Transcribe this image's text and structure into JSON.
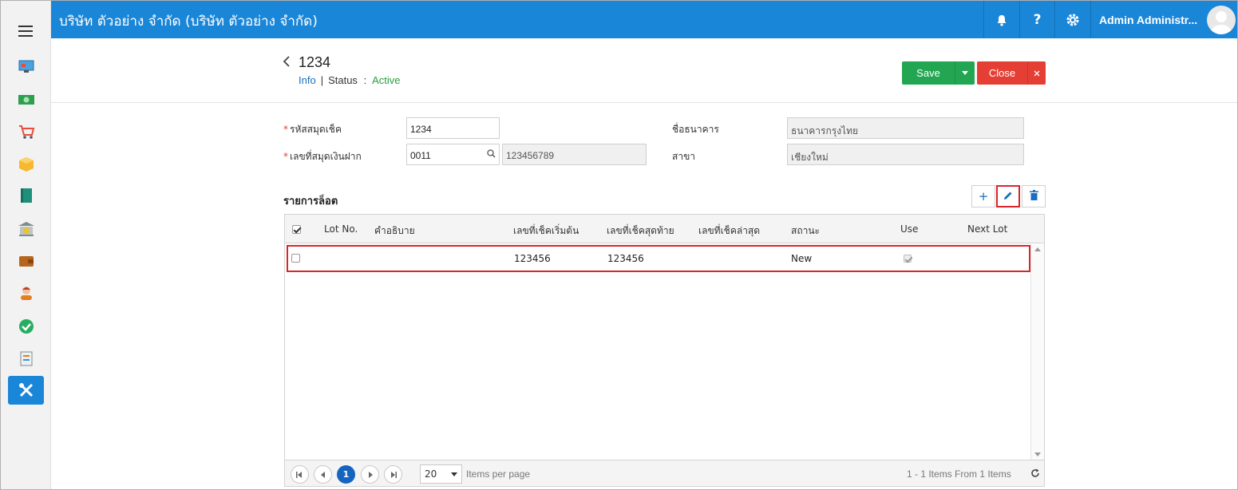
{
  "topbar": {
    "company": "บริษัท ตัวอย่าง จำกัด (บริษัท ตัวอย่าง จำกัด)",
    "help_label": "?",
    "user_name": "Admin Administr..."
  },
  "sidebar": {
    "items": [
      {
        "icon": "dashboard-icon"
      },
      {
        "icon": "money-icon"
      },
      {
        "icon": "cart-icon"
      },
      {
        "icon": "box-icon"
      },
      {
        "icon": "book-icon"
      },
      {
        "icon": "bank-icon"
      },
      {
        "icon": "wallet-icon"
      },
      {
        "icon": "person-icon"
      },
      {
        "icon": "check-circle-icon"
      },
      {
        "icon": "report-icon"
      },
      {
        "icon": "tools-icon",
        "active": true
      }
    ]
  },
  "header": {
    "title": "1234",
    "info_link": "Info",
    "separator": "|",
    "status_label": "Status",
    "status_colon": ":",
    "status_value": "Active",
    "save_label": "Save",
    "close_label": "Close"
  },
  "form": {
    "checkbook_code_label": "รหัสสมุดเช็ค",
    "checkbook_code_value": "1234",
    "account_no_label": "เลขที่สมุดเงินฝาก",
    "account_no_value": "0011",
    "account_name_value": "123456789",
    "bank_label": "ชื่อธนาคาร",
    "bank_value": "ธนาคารกรุงไทย",
    "branch_label": "สาขา",
    "branch_value": "เชียงใหม่"
  },
  "lot_section": {
    "title": "รายการล็อต",
    "add_symbol": "+"
  },
  "grid": {
    "headers": {
      "lot_no": "Lot No.",
      "description": "คำอธิบาย",
      "start_no": "เลขที่เช็คเริ่มต้น",
      "end_no": "เลขที่เช็คสุดท้าย",
      "last_no": "เลขที่เช็คล่าสุด",
      "status": "สถานะ",
      "use": "Use",
      "next_lot": "Next Lot"
    },
    "rows": [
      {
        "lot_no": "",
        "description": "",
        "start_no": "123456",
        "end_no": "123456",
        "last_no": "",
        "status": "New",
        "use": true,
        "next_lot": ""
      }
    ],
    "pager": {
      "current_page": "1",
      "page_size": "20",
      "items_per_page": "Items per page",
      "summary": "1 - 1 Items From 1 Items"
    }
  },
  "colors": {
    "brand": "#1a86d8",
    "save": "#22a652",
    "close": "#e53f35",
    "highlight": "#d9252b"
  }
}
